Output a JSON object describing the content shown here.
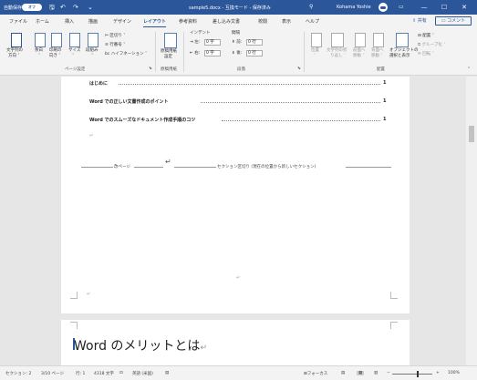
{
  "titlebar": {
    "autosave_label": "自動保存",
    "autosave_state": "オフ",
    "doc_title": "sample5.docx - 互換モード - 保存済み",
    "search_glyph": "⚲",
    "user": "Kohama Yoshie",
    "icons": {
      "save": "save-icon",
      "undo": "undo-icon",
      "redo": "redo-icon",
      "customize": "customize-icon"
    },
    "controls": [
      "—",
      "☐",
      "✕"
    ]
  },
  "tabs": [
    "ファイル",
    "ホーム",
    "挿入",
    "描画",
    "デザイン",
    "レイアウト",
    "参考資料",
    "差し込み文書",
    "校閲",
    "表示",
    "ヘルプ"
  ],
  "active_tab": "レイアウト",
  "share_label": "共有",
  "comment_label": "コメント",
  "ribbon": {
    "page_setup": {
      "text_direction": [
        "文字列の",
        "方向 ˅"
      ],
      "margins": [
        "余白",
        "˅"
      ],
      "orientation": [
        "印刷の",
        "向き ˅"
      ],
      "size": [
        "サイズ",
        "˅"
      ],
      "columns": [
        "段組み",
        "˅"
      ],
      "breaks": "区切り ˅",
      "line_numbers": "行番号 ˅",
      "hyphenation": "ハイフネーション ˅",
      "group_label": "ページ設定"
    },
    "genko": {
      "button": [
        "原稿用紙",
        "設定"
      ],
      "group_label": "原稿用紙"
    },
    "paragraph": {
      "indent_label": "インデント",
      "spacing_label": "間隔",
      "left_label": "左:",
      "left_value": "0 字",
      "right_label": "右:",
      "right_value": "0 字",
      "before_label": "前:",
      "before_value": "0 行",
      "after_label": "後:",
      "after_value": "0 行",
      "group_label": "段落"
    },
    "arrange": {
      "position": [
        "位置",
        "˅"
      ],
      "wrap_text": [
        "文字列の折",
        "り返し ˅"
      ],
      "bring_forward": [
        "前面へ",
        "移動 ˅"
      ],
      "send_backward": [
        "背面へ",
        "移動 ˅"
      ],
      "selection_pane": [
        "オブジェクトの",
        "選択と表示"
      ],
      "align": "配置 ˅",
      "group": "グループ化 ˅",
      "rotate": "回転 ˅",
      "group_label": "配置"
    }
  },
  "toc": [
    {
      "title": "はじめに",
      "page": "1"
    },
    {
      "title": "Word での正しい文書作成のポイント",
      "page": "1"
    },
    {
      "title": "Word でのスムーズなドキュメント作成手順のコツ",
      "page": "1"
    }
  ],
  "section_break": {
    "left": "改ページ",
    "center": "セクション区切り (現在の位置から新しいセクション)"
  },
  "para_mark": "↵",
  "page2_heading": "Word のメリットとは",
  "statusbar": {
    "section": "セクション: 2",
    "page": "3/10 ページ",
    "line": "行: 1",
    "words": "4318 文字",
    "lang": "英語 (米国)",
    "focus": "フォーカス",
    "zoom": "100%",
    "zoom_level": 1.0
  }
}
